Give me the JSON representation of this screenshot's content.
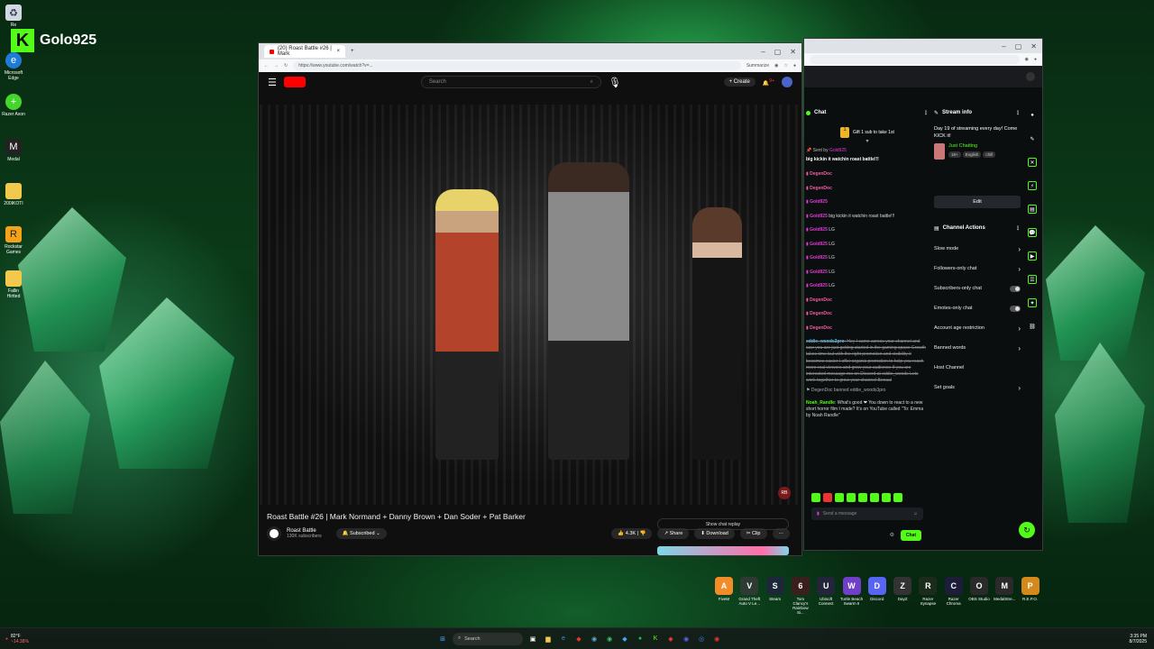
{
  "desktop": {
    "brand_name": "Golo925",
    "icons": [
      {
        "label": "Re",
        "icon": "recycle-bin-icon"
      },
      {
        "label": "Microsoft Edge",
        "icon": "edge-icon"
      },
      {
        "label": "Razer Axon",
        "icon": "razer-axon-icon"
      },
      {
        "label": "Medal",
        "icon": "medal-icon"
      },
      {
        "label": "200IKOTI",
        "icon": "folder-icon"
      },
      {
        "label": "Rockstar Games",
        "icon": "rockstar-icon"
      },
      {
        "label": "Fallin Hirtted",
        "icon": "folder-icon"
      }
    ]
  },
  "youtube_window": {
    "tab_title": "(20) Roast Battle #26 | Mark",
    "url": "https://www.youtube.com/watch?v=...",
    "search_placeholder": "Search",
    "create_label": "Create",
    "notification_count": "9+",
    "video_title": "Roast Battle #26 | Mark Normand + Danny Brown + Dan Soder + Pat Barker",
    "channel_name": "Roast Battle",
    "subscribers": "130K subscribers",
    "subscribed_label": "Subscribed",
    "likes": "4.3K",
    "share_label": "Share",
    "download_label": "Download",
    "clip_label": "Clip",
    "show_chat_replay": "Show chat replay",
    "address_right": "Summarize"
  },
  "kick_window": {
    "chat_header": "Chat",
    "gift_banner": "Gift 1 sub to take 1st",
    "pinned_by": "Sent by",
    "pinned_msg": "big kickin it watchin roast battle!!!",
    "chat_lines": [
      {
        "user": "DegenDoc",
        "text": "",
        "color": "#f45ba5"
      },
      {
        "user": "DegenDoc",
        "text": "",
        "color": "#f45ba5"
      },
      {
        "user": "Gold925",
        "text": "",
        "color": "#e23bd9"
      },
      {
        "user": "Gold925",
        "text": "big kickin it watchin roast battle!!!",
        "color": "#e23bd9"
      },
      {
        "user": "Gold925",
        "text": "LG",
        "color": "#e23bd9"
      },
      {
        "user": "Gold925",
        "text": "LG",
        "color": "#e23bd9"
      },
      {
        "user": "Gold925",
        "text": "LG",
        "color": "#e23bd9"
      },
      {
        "user": "Gold925",
        "text": "LG",
        "color": "#e23bd9"
      },
      {
        "user": "Gold925",
        "text": "LG",
        "color": "#e23bd9"
      },
      {
        "user": "DegenDoc",
        "text": "",
        "color": "#f45ba5"
      },
      {
        "user": "DegenDoc",
        "text": "",
        "color": "#f45ba5"
      },
      {
        "user": "DegenDoc",
        "text": "",
        "color": "#f45ba5"
      }
    ],
    "spam_user": "eddie_woods3pro",
    "spam_text": "Hey I came across your channel and saw you are just getting started in the gaming space Growth takes time but with the right promotion and visibility it becomes easier I offer organic promotion to help you reach more real viewers and grow your audience If you are interested message me on Discord at eddie_woods Lets work together to grow your channel Benaal",
    "ban_notice": "DegenDoc banned eddie_woods3pro",
    "last_user": "Noah_Randle",
    "last_text": "What's good ❤ You down to react to a new short horror film I made? It's on YouTube called \"To: Emma by Noah Randle\"",
    "send_placeholder": "Send a message",
    "chat_button": "Chat",
    "stream_info_header": "Stream info",
    "stream_title": "Day 19 of streaming every day! Come KICK it!",
    "category": "Just Chatting",
    "tags": [
      "18+",
      "English",
      "chill"
    ],
    "edit_label": "Edit",
    "channel_actions_header": "Channel Actions",
    "actions": [
      {
        "label": "Slow mode",
        "kind": "chevron"
      },
      {
        "label": "Followers-only chat",
        "kind": "chevron"
      },
      {
        "label": "Subscribers-only chat",
        "kind": "toggle"
      },
      {
        "label": "Emotes-only chat",
        "kind": "toggle"
      },
      {
        "label": "Account age restriction",
        "kind": "chevron"
      },
      {
        "label": "Banned words",
        "kind": "chevron"
      },
      {
        "label": "Host Channel",
        "kind": "none"
      },
      {
        "label": "Set goals",
        "kind": "chevron"
      }
    ]
  },
  "game_icons": [
    {
      "label": "FiveM",
      "color": "#f28c28",
      "glyph": "A"
    },
    {
      "label": "Grand Theft Auto V Le...",
      "color": "#2f3a33",
      "glyph": "V"
    },
    {
      "label": "Steam",
      "color": "#1b2838",
      "glyph": "S"
    },
    {
      "label": "Tom Clancy's Rainbow Si...",
      "color": "#3b1f1f",
      "glyph": "6"
    },
    {
      "label": "Ubisoft Connect",
      "color": "#23263a",
      "glyph": "U"
    },
    {
      "label": "Turtle Beach Swarm II",
      "color": "#6f3fc7",
      "glyph": "W"
    },
    {
      "label": "Discord",
      "color": "#5865f2",
      "glyph": "D"
    },
    {
      "label": "DayZ",
      "color": "#333333",
      "glyph": "Z"
    },
    {
      "label": "Razer Synapse",
      "color": "#1c2c1c",
      "glyph": "R"
    },
    {
      "label": "Razer Chroma",
      "color": "#1d1d3a",
      "glyph": "C"
    },
    {
      "label": "OBS Studio",
      "color": "#2a2a2a",
      "glyph": "O"
    },
    {
      "label": "MedalStre...",
      "color": "#2a2a2a",
      "glyph": "M"
    },
    {
      "label": "R.E.P.O.",
      "color": "#d48a1a",
      "glyph": "P"
    }
  ],
  "taskbar": {
    "weather": "82°F",
    "weather_sub": "~14.38%",
    "search_placeholder": "Search",
    "time": "3:35 PM",
    "date": "8/7/2025"
  }
}
